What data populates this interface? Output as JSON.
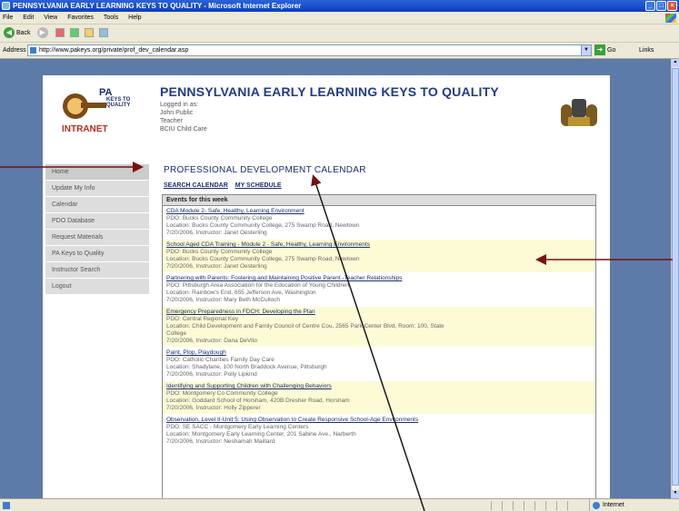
{
  "window": {
    "title": "PENNSYLVANIA EARLY LEARNING KEYS TO QUALITY - Microsoft Internet Explorer"
  },
  "menu": [
    "File",
    "Edit",
    "View",
    "Favorites",
    "Tools",
    "Help"
  ],
  "toolbar": {
    "back_label": "Back"
  },
  "address": {
    "label": "Address",
    "url": "http://www.pakeys.org/private/prof_dev_calendar.asp",
    "go_label": "Go",
    "links_label": "Links"
  },
  "header": {
    "logo": {
      "pa": "PA",
      "keys": "KEYS TO QUALITY",
      "intranet": "INTRANET"
    },
    "site_title": "PENNSYLVANIA EARLY LEARNING KEYS TO QUALITY",
    "login_label": "Logged in as:",
    "user_name": "John Public",
    "user_role": "Teacher",
    "user_org": "BCIU Child Care"
  },
  "sidebar": {
    "items": [
      {
        "label": "Home"
      },
      {
        "label": "Update My Info"
      },
      {
        "label": "Calendar"
      },
      {
        "label": "PDO Database"
      },
      {
        "label": "Request Materials"
      },
      {
        "label": "PA Keys to Quality"
      },
      {
        "label": "Instructor Search"
      },
      {
        "label": "Logout"
      }
    ]
  },
  "main": {
    "title": "PROFESSIONAL DEVELOPMENT CALENDAR",
    "links": {
      "search": "SEARCH CALENDAR",
      "schedule": "MY SCHEDULE"
    },
    "events_header": "Events for this week",
    "events": [
      {
        "title": "CDA Module 2- Safe, Healthy, Learning Environment",
        "pdo": "PDO: Bucks County Community College",
        "location": "Location: Bucks County Community College, 275 Swamp Road, Newtown",
        "date": "7/20/2006, Instructor: Janet Oesterling"
      },
      {
        "title": "School Aged CDA Training - Module 2 - Safe, Healthy, Learning Environments",
        "pdo": "PDO: Bucks County Community College",
        "location": "Location: Bucks County Community College, 275 Swamp Road, Newtown",
        "date": "7/20/2006, Instructor: Janet Oesterling"
      },
      {
        "title": "Partnering with Parents: Fostering and Maintaining Positive Parent -Teacher Relationships",
        "pdo": "PDO: Pittsburgh Area Association for the Education of Young Children",
        "location": "Location: Rainbow's End, 655 Jefferson Ave, Washington",
        "date": "7/20/2006, Instructor: Mary Beth McCulloch"
      },
      {
        "title": "Emergency Preparedness in FDCH: Developing the Plan",
        "pdo": "PDO: Central Regional Key",
        "location": "Location: Child Development and Family Council of Centre Cou, 2565 Park Center Blvd, Room: 100, State",
        "location2": "College",
        "date": "7/20/2006, Instructor: Dana DeVito"
      },
      {
        "title": "Paint, Plop, Playdough",
        "pdo": "PDO: Catholic Charities Family Day Care",
        "location": "Location: Shadylane, 100 North Braddock Avenue, Pittsburgh",
        "date": "7/20/2006, Instructor: Polly Lipkind"
      },
      {
        "title": "Identifying and Supporting Children with Challenging Behaviors",
        "pdo": "PDO: Montgomery Co Community College",
        "location": "Location: Goddard School of Horsham, 420B Dresher Road, Horsham",
        "date": "7/20/2006, Instructor: Holly Zipperer"
      },
      {
        "title": "Observation, Level II-Unit 5: Using Observation to Create Responsive School-Age Environments",
        "pdo": "PDO: SE SACC - Montgomery Early Learning Centers",
        "location": "Location: Montgomery Early Learning Center, 201 Sabine Ave., Narberth",
        "date": "7/20/2006, Instructor: Neshamah Maillard"
      }
    ]
  },
  "status": {
    "zone": "Internet"
  }
}
